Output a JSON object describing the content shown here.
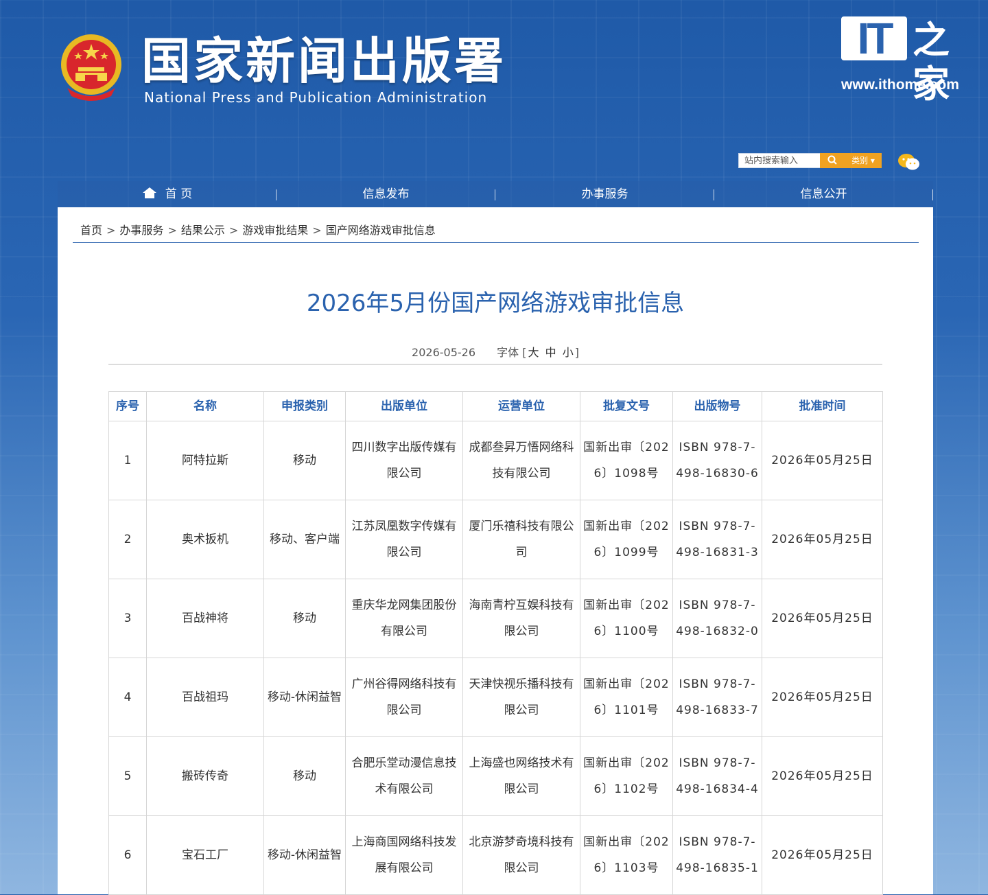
{
  "header": {
    "title": "国家新闻出版署",
    "subtitle": "National Press and Publication Administration",
    "watermark_logo": "IT之家",
    "watermark_url": "www.ithome.com"
  },
  "search": {
    "placeholder": "站内搜索输入",
    "button_icon": "search-icon",
    "category_label": "类别"
  },
  "nav": {
    "items": [
      {
        "label": "首 页"
      },
      {
        "label": "信息发布"
      },
      {
        "label": "办事服务"
      },
      {
        "label": "信息公开"
      }
    ]
  },
  "breadcrumb": [
    "首页",
    "办事服务",
    "结果公示",
    "游戏审批结果",
    "国产网络游戏审批信息"
  ],
  "article": {
    "title": "2026年5月份国产网络游戏审批信息",
    "date": "2026-05-26",
    "font_label": "字体",
    "font_sizes": [
      "大",
      "中",
      "小"
    ]
  },
  "table": {
    "headers": [
      "序号",
      "名称",
      "申报类别",
      "出版单位",
      "运营单位",
      "批复文号",
      "出版物号",
      "批准时间"
    ],
    "rows": [
      [
        "1",
        "阿特拉斯",
        "移动",
        "四川数字出版传媒有限公司",
        "成都叁昇万悟网络科技有限公司",
        "国新出审〔2026〕1098号",
        "ISBN 978-7-498-16830-6",
        "2026年05月25日"
      ],
      [
        "2",
        "奥术扳机",
        "移动、客户端",
        "江苏凤凰数字传媒有限公司",
        "厦门乐禧科技有限公司",
        "国新出审〔2026〕1099号",
        "ISBN 978-7-498-16831-3",
        "2026年05月25日"
      ],
      [
        "3",
        "百战神将",
        "移动",
        "重庆华龙网集团股份有限公司",
        "海南青柠互娱科技有限公司",
        "国新出审〔2026〕1100号",
        "ISBN 978-7-498-16832-0",
        "2026年05月25日"
      ],
      [
        "4",
        "百战祖玛",
        "移动-休闲益智",
        "广州谷得网络科技有限公司",
        "天津快视乐播科技有限公司",
        "国新出审〔2026〕1101号",
        "ISBN 978-7-498-16833-7",
        "2026年05月25日"
      ],
      [
        "5",
        "搬砖传奇",
        "移动",
        "合肥乐堂动漫信息技术有限公司",
        "上海盛也网络技术有限公司",
        "国新出审〔2026〕1102号",
        "ISBN 978-7-498-16834-4",
        "2026年05月25日"
      ],
      [
        "6",
        "宝石工厂",
        "移动-休闲益智",
        "上海商国网络科技发展有限公司",
        "北京游梦奇境科技有限公司",
        "国新出审〔2026〕1103号",
        "ISBN 978-7-498-16835-1",
        "2026年05月25日"
      ]
    ]
  },
  "colors": {
    "brand_blue": "#2a62ae",
    "accent_orange": "#f0a221"
  }
}
